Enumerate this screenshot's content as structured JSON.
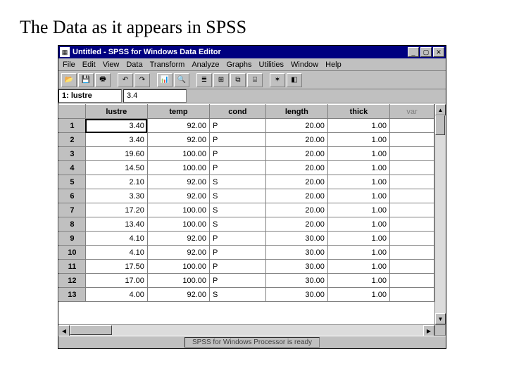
{
  "slide_title": "The Data as it appears in SPSS",
  "window": {
    "title": "Untitled - SPSS for Windows Data Editor",
    "sys_icon": "▦"
  },
  "menus": [
    "File",
    "Edit",
    "View",
    "Data",
    "Transform",
    "Analyze",
    "Graphs",
    "Utilities",
    "Window",
    "Help"
  ],
  "toolbar_icons": {
    "open": "📂",
    "save": "💾",
    "print": "🖶",
    "undo": "↶",
    "redo": "↷",
    "chart": "📊",
    "find": "🔍",
    "i1": "≣",
    "i2": "⊞",
    "i3": "⧉",
    "i4": "⌸",
    "i5": "✶",
    "i6": "◧"
  },
  "cell_ref": {
    "label": "1: lustre",
    "value": "3.4"
  },
  "columns": [
    "lustre",
    "temp",
    "cond",
    "length",
    "thick",
    "var"
  ],
  "rows": [
    {
      "n": "1",
      "lustre": "3.40",
      "temp": "92.00",
      "cond": "P",
      "length": "20.00",
      "thick": "1.00"
    },
    {
      "n": "2",
      "lustre": "3.40",
      "temp": "92.00",
      "cond": "P",
      "length": "20.00",
      "thick": "1.00"
    },
    {
      "n": "3",
      "lustre": "19.60",
      "temp": "100.00",
      "cond": "P",
      "length": "20.00",
      "thick": "1.00"
    },
    {
      "n": "4",
      "lustre": "14.50",
      "temp": "100.00",
      "cond": "P",
      "length": "20.00",
      "thick": "1.00"
    },
    {
      "n": "5",
      "lustre": "2.10",
      "temp": "92.00",
      "cond": "S",
      "length": "20.00",
      "thick": "1.00"
    },
    {
      "n": "6",
      "lustre": "3.30",
      "temp": "92.00",
      "cond": "S",
      "length": "20.00",
      "thick": "1.00"
    },
    {
      "n": "7",
      "lustre": "17.20",
      "temp": "100.00",
      "cond": "S",
      "length": "20.00",
      "thick": "1.00"
    },
    {
      "n": "8",
      "lustre": "13.40",
      "temp": "100.00",
      "cond": "S",
      "length": "20.00",
      "thick": "1.00"
    },
    {
      "n": "9",
      "lustre": "4.10",
      "temp": "92.00",
      "cond": "P",
      "length": "30.00",
      "thick": "1.00"
    },
    {
      "n": "10",
      "lustre": "4.10",
      "temp": "92.00",
      "cond": "P",
      "length": "30.00",
      "thick": "1.00"
    },
    {
      "n": "11",
      "lustre": "17.50",
      "temp": "100.00",
      "cond": "P",
      "length": "30.00",
      "thick": "1.00"
    },
    {
      "n": "12",
      "lustre": "17.00",
      "temp": "100.00",
      "cond": "P",
      "length": "30.00",
      "thick": "1.00"
    },
    {
      "n": "13",
      "lustre": "4.00",
      "temp": "92.00",
      "cond": "S",
      "length": "30.00",
      "thick": "1.00"
    }
  ],
  "status": "SPSS for Windows Processor is ready",
  "winctrl": {
    "min": "_",
    "max": "▢",
    "close": "✕"
  },
  "scroll": {
    "up": "▲",
    "down": "▼",
    "left": "◀",
    "right": "▶"
  }
}
